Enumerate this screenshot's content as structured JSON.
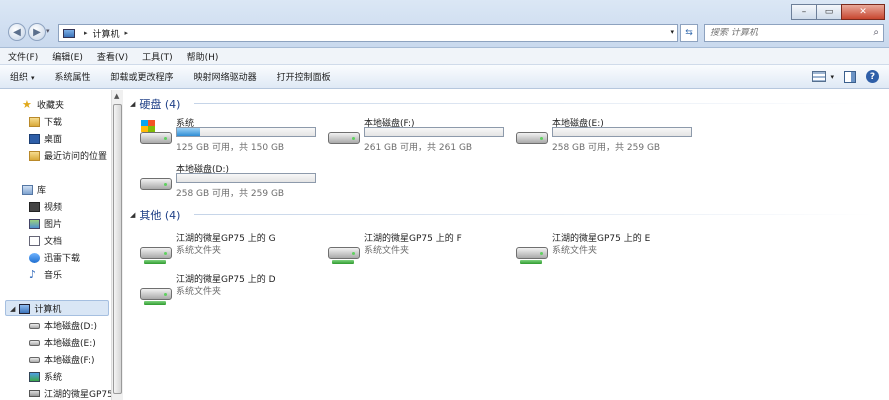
{
  "titlebar": {
    "window_buttons": [
      "minimize-icon",
      "maximize-icon",
      "close-icon"
    ],
    "nav_back_icon": "back-arrow-icon",
    "nav_forward_icon": "forward-arrow-icon",
    "address_path": "计算机",
    "address_arrow": "▸",
    "search_placeholder": "搜索 计算机"
  },
  "menu": [
    "文件(F)",
    "编辑(E)",
    "查看(V)",
    "工具(T)",
    "帮助(H)"
  ],
  "commands": [
    {
      "label": "组织",
      "has_dropdown": true
    },
    {
      "label": "系统属性"
    },
    {
      "label": "卸载或更改程序"
    },
    {
      "label": "映射网络驱动器"
    },
    {
      "label": "打开控制面板"
    }
  ],
  "sidebar": {
    "items": [
      {
        "label": "收藏夹",
        "icon": "star-icon"
      },
      {
        "label": "下载",
        "icon": "folder-icon"
      },
      {
        "label": "桌面",
        "icon": "desktop-icon"
      },
      {
        "label": "最近访问的位置",
        "icon": "recent-icon"
      },
      {
        "label": "库",
        "icon": "library-icon"
      },
      {
        "label": "视频",
        "icon": "video-icon"
      },
      {
        "label": "图片",
        "icon": "picture-icon"
      },
      {
        "label": "文档",
        "icon": "document-icon"
      },
      {
        "label": "迅雷下载",
        "icon": "thunder-icon"
      },
      {
        "label": "音乐",
        "icon": "music-icon"
      },
      {
        "label": "计算机",
        "icon": "computer-icon"
      },
      {
        "label": "本地磁盘(D:)",
        "icon": "drive-icon"
      },
      {
        "label": "本地磁盘(E:)",
        "icon": "drive-icon"
      },
      {
        "label": "本地磁盘(F:)",
        "icon": "drive-icon"
      },
      {
        "label": "系统",
        "icon": "system-drive-icon"
      },
      {
        "label": "江湖的微星GP75",
        "icon": "network-drive-icon"
      }
    ]
  },
  "groups": {
    "drives": {
      "title": "硬盘 (4)"
    },
    "others": {
      "title": "其他 (4)"
    }
  },
  "drives": [
    {
      "name": "系统",
      "info": "125 GB 可用，共 150 GB",
      "used_fraction": 0.17,
      "windows": true
    },
    {
      "name": "本地磁盘(F:)",
      "info": "261 GB 可用，共 261 GB",
      "used_fraction": 0.0
    },
    {
      "name": "本地磁盘(E:)",
      "info": "258 GB 可用，共 259 GB",
      "used_fraction": 0.0
    },
    {
      "name": "本地磁盘(D:)",
      "info": "258 GB 可用，共 259 GB",
      "used_fraction": 0.0
    }
  ],
  "others": [
    {
      "name": "江湖的微星GP75 上的 G",
      "sub": "系统文件夹"
    },
    {
      "name": "江湖的微星GP75 上的 F",
      "sub": "系统文件夹"
    },
    {
      "name": "江湖的微星GP75 上的 E",
      "sub": "系统文件夹"
    },
    {
      "name": "江湖的微星GP75 上的 D",
      "sub": "系统文件夹"
    }
  ]
}
